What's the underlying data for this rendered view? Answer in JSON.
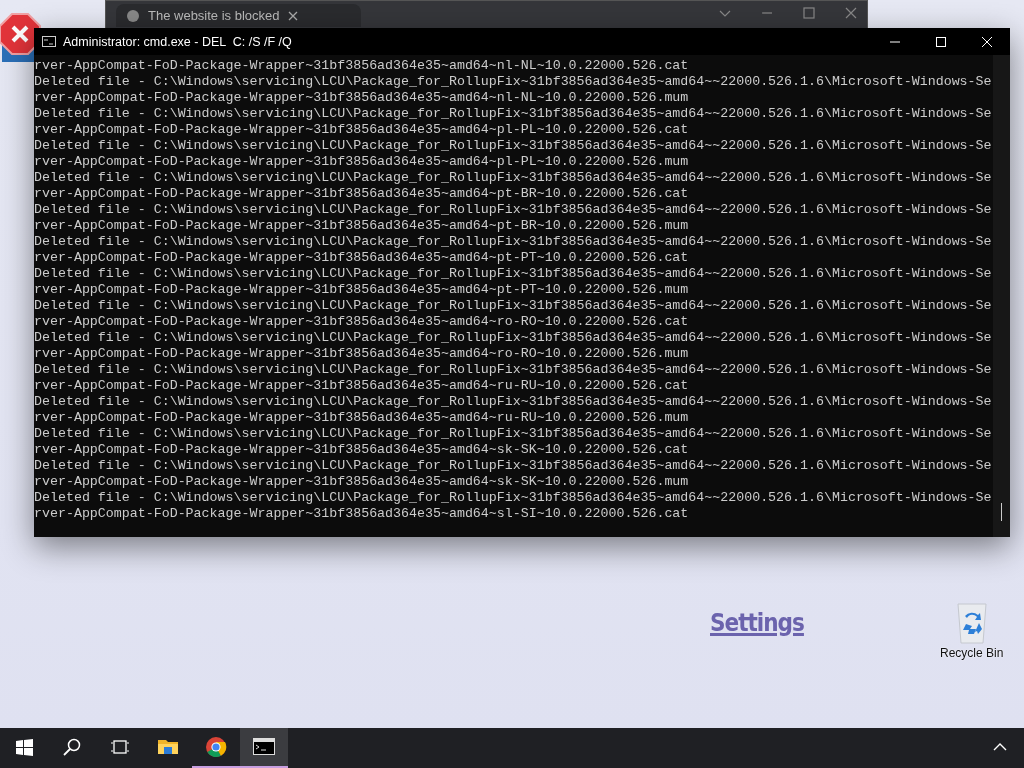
{
  "browser_window": {
    "tab_title": "The website is blocked"
  },
  "console_window": {
    "title": "Administrator: cmd.exe - DEL  C: /S /F /Q",
    "lines": [
      "rver-AppCompat-FoD-Package-Wrapper~31bf3856ad364e35~amd64~nl-NL~10.0.22000.526.cat",
      "Deleted file - C:\\Windows\\servicing\\LCU\\Package_for_RollupFix~31bf3856ad364e35~amd64~~22000.526.1.6\\Microsoft-Windows-Se",
      "rver-AppCompat-FoD-Package-Wrapper~31bf3856ad364e35~amd64~nl-NL~10.0.22000.526.mum",
      "Deleted file - C:\\Windows\\servicing\\LCU\\Package_for_RollupFix~31bf3856ad364e35~amd64~~22000.526.1.6\\Microsoft-Windows-Se",
      "rver-AppCompat-FoD-Package-Wrapper~31bf3856ad364e35~amd64~pl-PL~10.0.22000.526.cat",
      "Deleted file - C:\\Windows\\servicing\\LCU\\Package_for_RollupFix~31bf3856ad364e35~amd64~~22000.526.1.6\\Microsoft-Windows-Se",
      "rver-AppCompat-FoD-Package-Wrapper~31bf3856ad364e35~amd64~pl-PL~10.0.22000.526.mum",
      "Deleted file - C:\\Windows\\servicing\\LCU\\Package_for_RollupFix~31bf3856ad364e35~amd64~~22000.526.1.6\\Microsoft-Windows-Se",
      "rver-AppCompat-FoD-Package-Wrapper~31bf3856ad364e35~amd64~pt-BR~10.0.22000.526.cat",
      "Deleted file - C:\\Windows\\servicing\\LCU\\Package_for_RollupFix~31bf3856ad364e35~amd64~~22000.526.1.6\\Microsoft-Windows-Se",
      "rver-AppCompat-FoD-Package-Wrapper~31bf3856ad364e35~amd64~pt-BR~10.0.22000.526.mum",
      "Deleted file - C:\\Windows\\servicing\\LCU\\Package_for_RollupFix~31bf3856ad364e35~amd64~~22000.526.1.6\\Microsoft-Windows-Se",
      "rver-AppCompat-FoD-Package-Wrapper~31bf3856ad364e35~amd64~pt-PT~10.0.22000.526.cat",
      "Deleted file - C:\\Windows\\servicing\\LCU\\Package_for_RollupFix~31bf3856ad364e35~amd64~~22000.526.1.6\\Microsoft-Windows-Se",
      "rver-AppCompat-FoD-Package-Wrapper~31bf3856ad364e35~amd64~pt-PT~10.0.22000.526.mum",
      "Deleted file - C:\\Windows\\servicing\\LCU\\Package_for_RollupFix~31bf3856ad364e35~amd64~~22000.526.1.6\\Microsoft-Windows-Se",
      "rver-AppCompat-FoD-Package-Wrapper~31bf3856ad364e35~amd64~ro-RO~10.0.22000.526.cat",
      "Deleted file - C:\\Windows\\servicing\\LCU\\Package_for_RollupFix~31bf3856ad364e35~amd64~~22000.526.1.6\\Microsoft-Windows-Se",
      "rver-AppCompat-FoD-Package-Wrapper~31bf3856ad364e35~amd64~ro-RO~10.0.22000.526.mum",
      "Deleted file - C:\\Windows\\servicing\\LCU\\Package_for_RollupFix~31bf3856ad364e35~amd64~~22000.526.1.6\\Microsoft-Windows-Se",
      "rver-AppCompat-FoD-Package-Wrapper~31bf3856ad364e35~amd64~ru-RU~10.0.22000.526.cat",
      "Deleted file - C:\\Windows\\servicing\\LCU\\Package_for_RollupFix~31bf3856ad364e35~amd64~~22000.526.1.6\\Microsoft-Windows-Se",
      "rver-AppCompat-FoD-Package-Wrapper~31bf3856ad364e35~amd64~ru-RU~10.0.22000.526.mum",
      "Deleted file - C:\\Windows\\servicing\\LCU\\Package_for_RollupFix~31bf3856ad364e35~amd64~~22000.526.1.6\\Microsoft-Windows-Se",
      "rver-AppCompat-FoD-Package-Wrapper~31bf3856ad364e35~amd64~sk-SK~10.0.22000.526.cat",
      "Deleted file - C:\\Windows\\servicing\\LCU\\Package_for_RollupFix~31bf3856ad364e35~amd64~~22000.526.1.6\\Microsoft-Windows-Se",
      "rver-AppCompat-FoD-Package-Wrapper~31bf3856ad364e35~amd64~sk-SK~10.0.22000.526.mum",
      "Deleted file - C:\\Windows\\servicing\\LCU\\Package_for_RollupFix~31bf3856ad364e35~amd64~~22000.526.1.6\\Microsoft-Windows-Se",
      "rver-AppCompat-FoD-Package-Wrapper~31bf3856ad364e35~amd64~sl-SI~10.0.22000.526.cat"
    ]
  },
  "desktop": {
    "link": "Settings",
    "icons": [
      {
        "label": "Recycle Bin"
      }
    ]
  },
  "taskbar": {
    "apps": [
      {
        "kind": "explorer",
        "running": false,
        "active": false
      },
      {
        "kind": "chrome",
        "running": true,
        "active": false
      },
      {
        "kind": "cmd",
        "running": true,
        "active": true
      }
    ]
  }
}
